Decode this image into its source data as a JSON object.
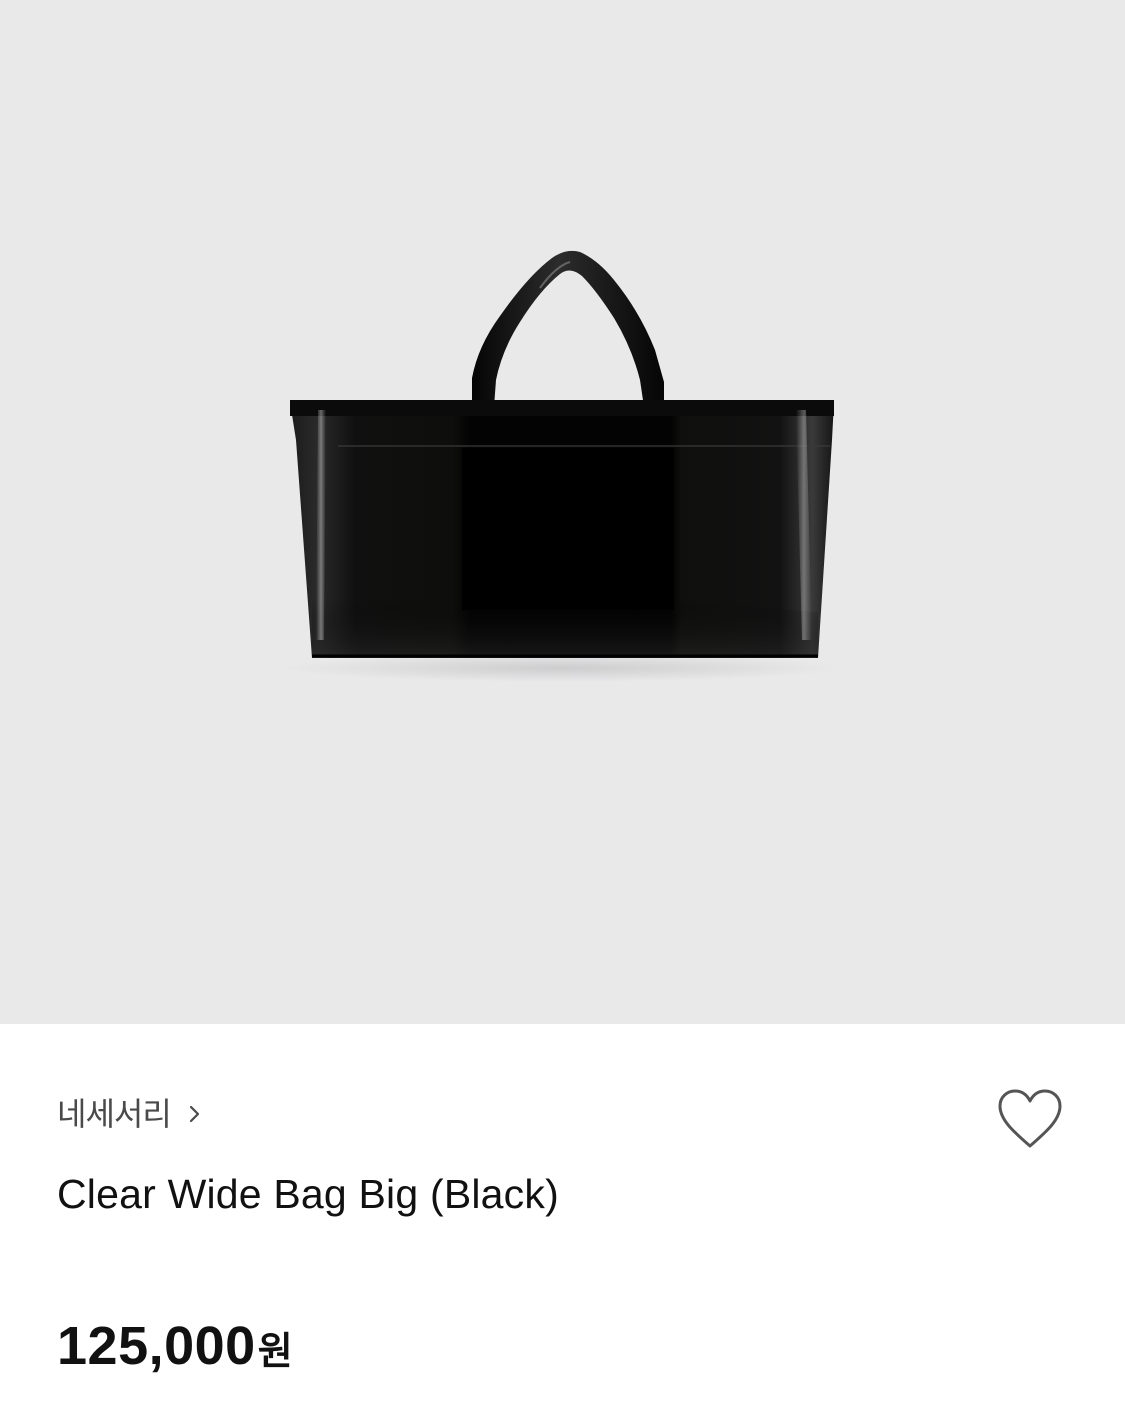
{
  "product": {
    "brand": "네세서리",
    "title": "Clear Wide Bag Big (Black)",
    "price_amount": "125,000",
    "price_unit": "원"
  },
  "icons": {
    "brand_link": "chevron-right-icon",
    "like": "heart-outline-icon"
  },
  "image": {
    "subject": "black clear tote bag",
    "background_color": "#e9e9ea"
  },
  "colors": {
    "text_primary": "#111111",
    "text_secondary": "#4a4a4a",
    "icon_stroke": "#555555"
  }
}
